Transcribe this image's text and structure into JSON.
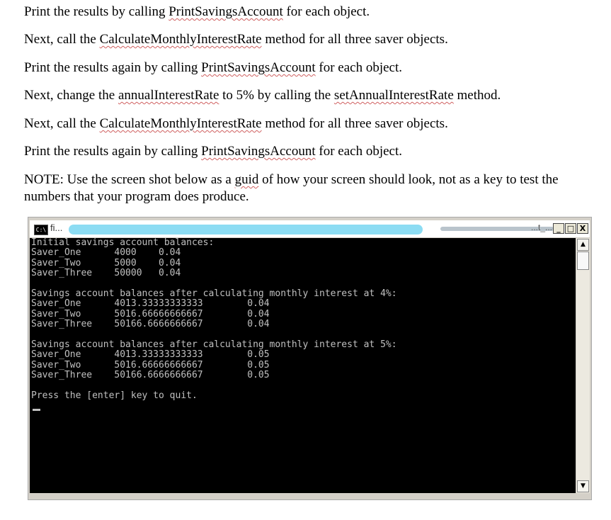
{
  "document": {
    "line1": {
      "pre": "Print the results by calling ",
      "term": "PrintSavingsAccount",
      "post": " for each object."
    },
    "line2": {
      "pre": "Next, call the ",
      "term": "CalculateMonthlyInterestRate",
      "post": " method for all three saver objects."
    },
    "line3": {
      "pre": "Print the results again by calling ",
      "term": "PrintSavingsAccount",
      "post": " for each object."
    },
    "line4": {
      "pre": "Next, change the ",
      "term1": "annualInterestRate",
      "mid": " to 5% by calling the ",
      "term2": "setAnnualInterestRate",
      "post": " method."
    },
    "line5": {
      "pre": "Next, call the ",
      "term": "CalculateMonthlyInterestRate",
      "post": " method for all three saver objects."
    },
    "line6": {
      "pre": "Print the results again by calling ",
      "term": "PrintSavingsAccount",
      "post": " for each object."
    },
    "note": {
      "pre": "NOTE:  Use the screen shot below as a ",
      "term": "guid",
      "post": " of how your screen should look, not as a key to test the numbers that your program does produce."
    }
  },
  "console_window": {
    "title": "fi...",
    "title_right": "...t_...",
    "icon_label": "C:\\",
    "minimize_symbol": "_",
    "maximize_symbol": "□",
    "close_symbol": "X",
    "scroll_up_symbol": "▲",
    "scroll_down_symbol": "▼",
    "output": "Initial savings account balances:\nSaver_One      4000    0.04\nSaver_Two      5000    0.04\nSaver_Three    50000   0.04\n\nSavings account balances after calculating monthly interest at 4%:\nSaver_One      4013.33333333333        0.04\nSaver_Two      5016.66666666667        0.04\nSaver_Three    50166.6666666667        0.04\n\nSavings account balances after calculating monthly interest at 5%:\nSaver_One      4013.33333333333        0.05\nSaver_Two      5016.66666666667        0.05\nSaver_Three    50166.6666666667        0.05\n\nPress the [enter] key to quit."
  }
}
